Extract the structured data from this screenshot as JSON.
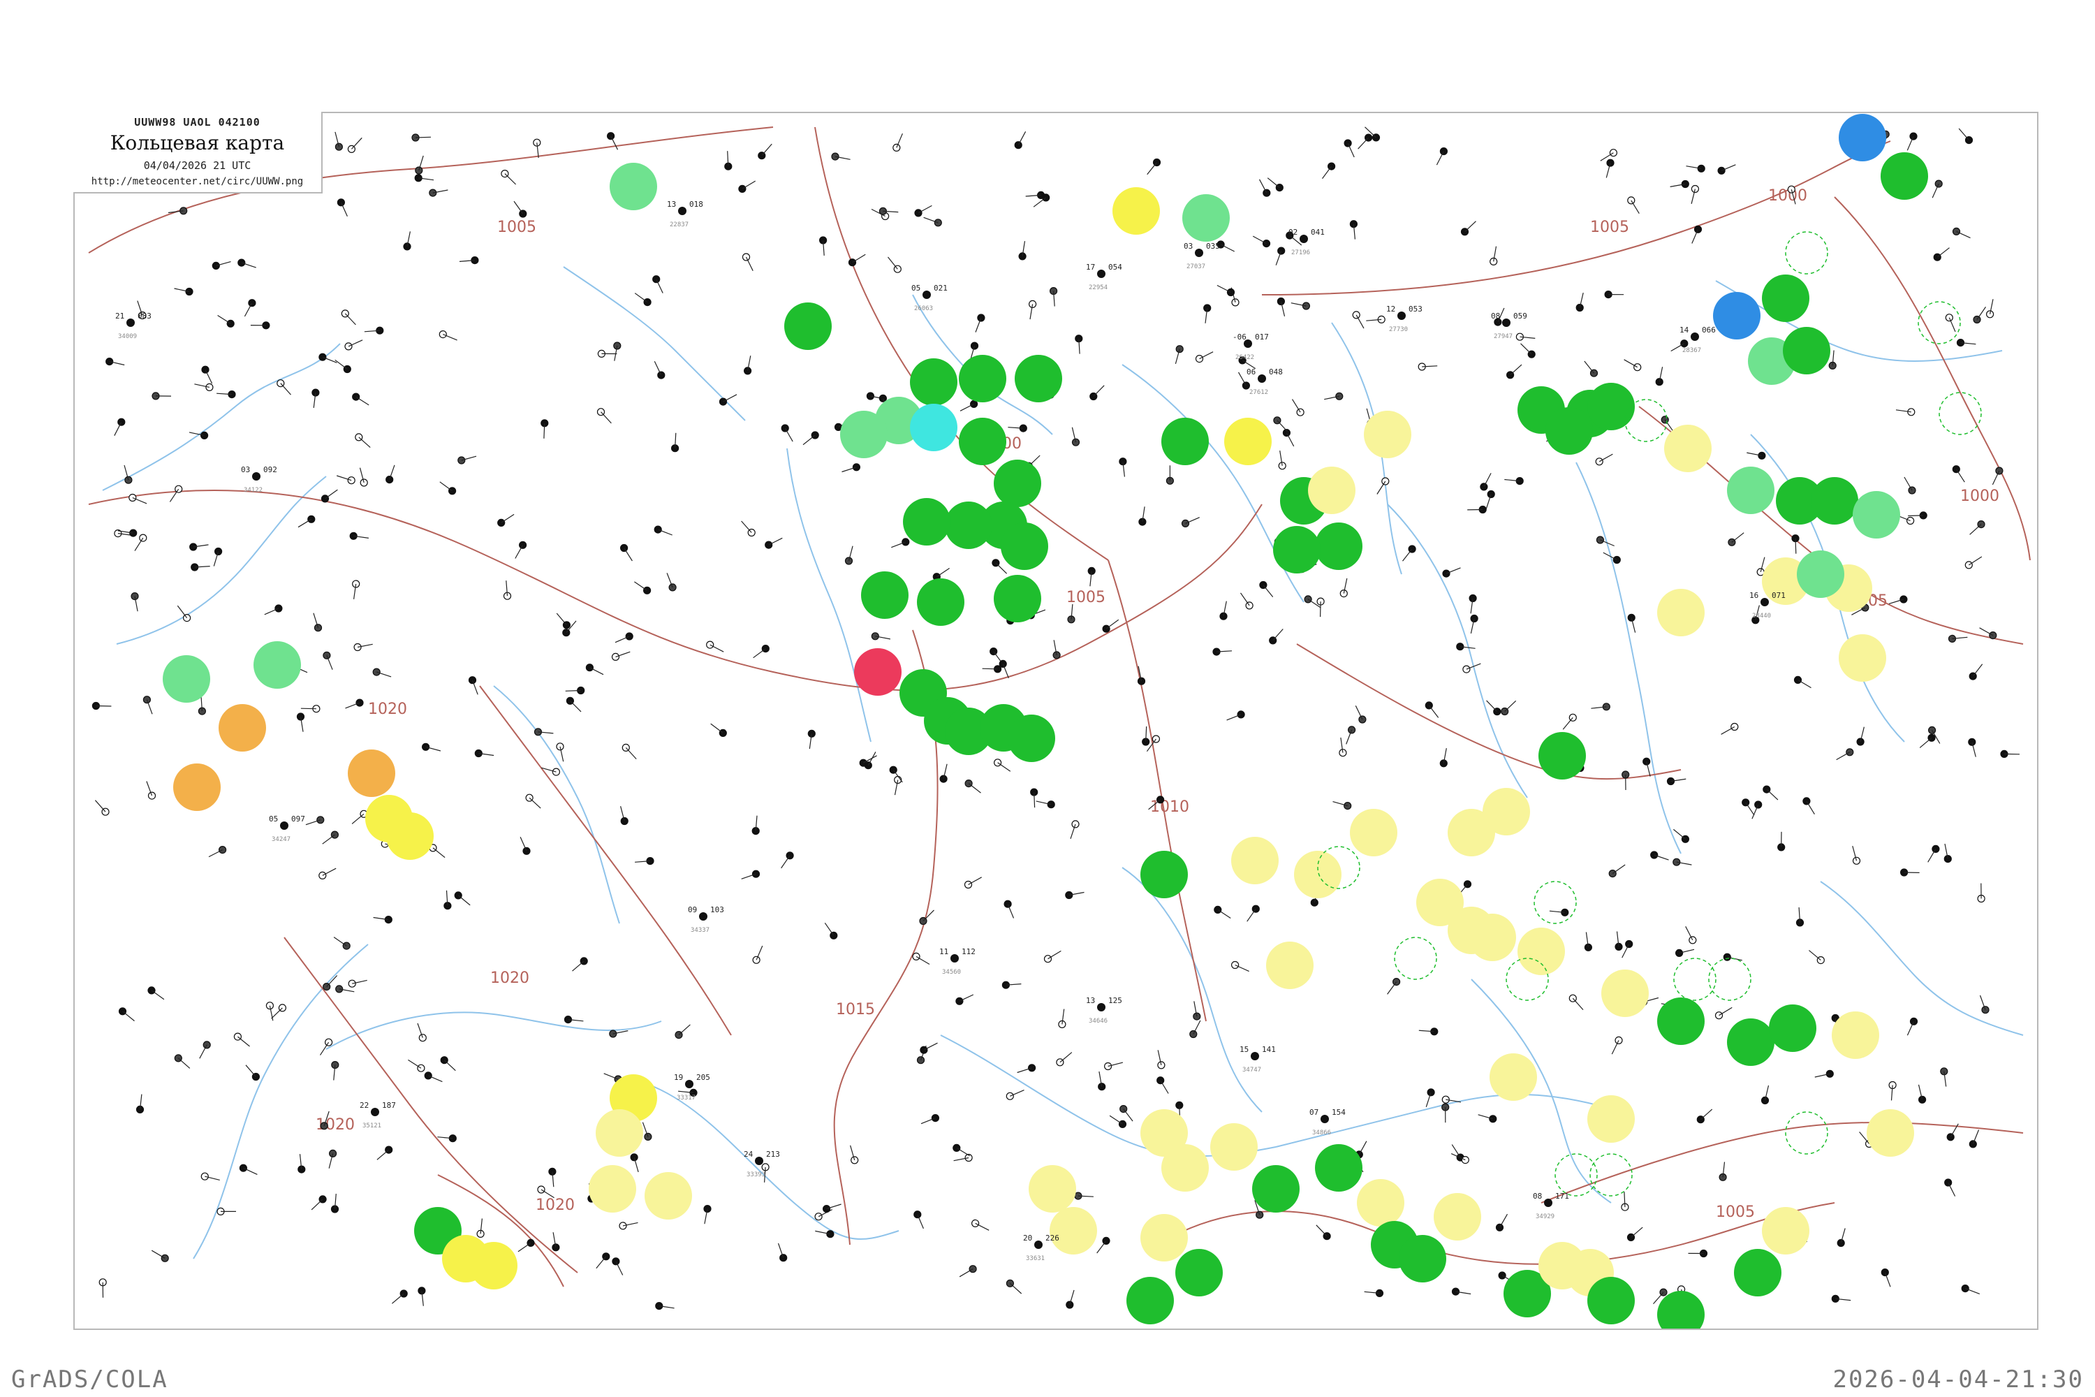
{
  "header": {
    "code": "UUWW98  UAOL  042100",
    "title": "Кольцевая карта",
    "date": "04/04/2026 21 UTC",
    "url": "http://meteocenter.net/circ/UUWW.png"
  },
  "footer": {
    "left": "GrADS/COLA",
    "right": "2026-04-04-21:30"
  },
  "colors": {
    "isobar": "#b5625a",
    "river": "#8fc3ea",
    "green": "#1fbe2e",
    "light_green": "#6fe28f",
    "yellow": "#f6f24a",
    "light_yellow": "#f8f49a",
    "orange": "#f3b04a",
    "blue": "#2f8de4",
    "cyan": "#3fe6e0",
    "red": "#ec3a5c",
    "frame": "#b8b8b8"
  },
  "isobar_labels": [
    "1005",
    "1000",
    "1005",
    "1010",
    "1015",
    "1020",
    "1020",
    "1020",
    "1020",
    "1000",
    "1000",
    "1005",
    "1005",
    "1005"
  ],
  "stations": [
    {
      "t": "13",
      "p": "018",
      "id": "22837"
    },
    {
      "t": "17",
      "p": "054",
      "id": "22954"
    },
    {
      "t": "-06",
      "p": "017",
      "id": "26422"
    },
    {
      "t": "05",
      "p": "021",
      "id": "26063"
    },
    {
      "t": "03",
      "p": "035",
      "id": "27037"
    },
    {
      "t": "02",
      "p": "041",
      "id": "27196"
    },
    {
      "t": "06",
      "p": "048",
      "id": "27612"
    },
    {
      "t": "12",
      "p": "053",
      "id": "27730"
    },
    {
      "t": "08",
      "p": "059",
      "id": "27947"
    },
    {
      "t": "14",
      "p": "066",
      "id": "28367"
    },
    {
      "t": "16",
      "p": "071",
      "id": "28440"
    },
    {
      "t": "21",
      "p": "083",
      "id": "34009"
    },
    {
      "t": "03",
      "p": "092",
      "id": "34122"
    },
    {
      "t": "05",
      "p": "097",
      "id": "34247"
    },
    {
      "t": "09",
      "p": "103",
      "id": "34337"
    },
    {
      "t": "11",
      "p": "112",
      "id": "34560"
    },
    {
      "t": "13",
      "p": "125",
      "id": "34646"
    },
    {
      "t": "15",
      "p": "141",
      "id": "34747"
    },
    {
      "t": "07",
      "p": "154",
      "id": "34866"
    },
    {
      "t": "08",
      "p": "171",
      "id": "34929"
    },
    {
      "t": "22",
      "p": "187",
      "id": "35121"
    },
    {
      "t": "19",
      "p": "205",
      "id": "33317"
    },
    {
      "t": "24",
      "p": "213",
      "id": "33393"
    },
    {
      "t": "20",
      "p": "226",
      "id": "33631"
    }
  ]
}
